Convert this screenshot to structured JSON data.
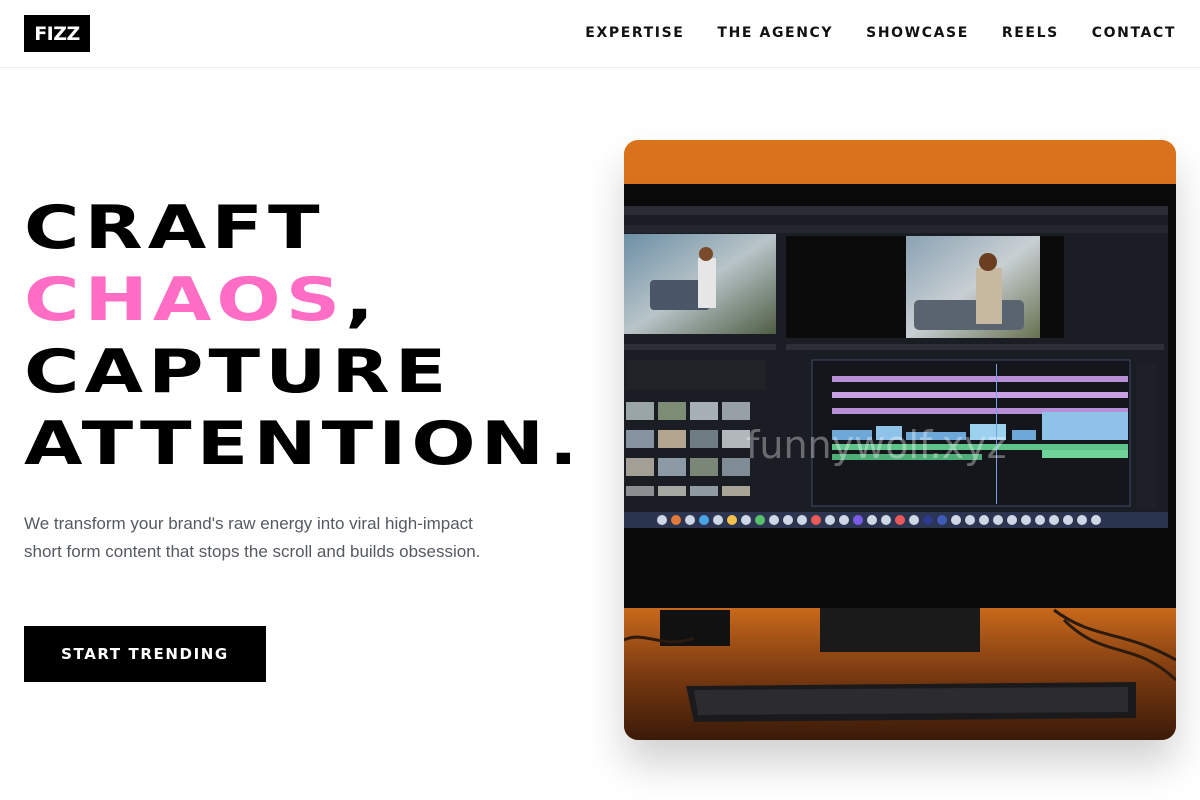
{
  "brand": {
    "logo_text": "FIZZ"
  },
  "nav": {
    "items": [
      {
        "label": "EXPERTISE"
      },
      {
        "label": "THE AGENCY"
      },
      {
        "label": "SHOWCASE"
      },
      {
        "label": "REELS"
      },
      {
        "label": "CONTACT"
      }
    ]
  },
  "hero": {
    "headline": {
      "line1": "CRAFT",
      "line2_accent": "CHAOS",
      "line2_rest": ",",
      "line3": "CAPTURE",
      "line4": "ATTENTION."
    },
    "subtext": "We transform your brand's raw energy into viral high-impact short form content that stops the scroll and builds obsession.",
    "cta_label": "START TRENDING",
    "image": {
      "watermark": "funnywolf.xyz"
    }
  },
  "colors": {
    "accent": "#ff6ec4",
    "button": "#000000",
    "text_muted": "#555a60"
  }
}
